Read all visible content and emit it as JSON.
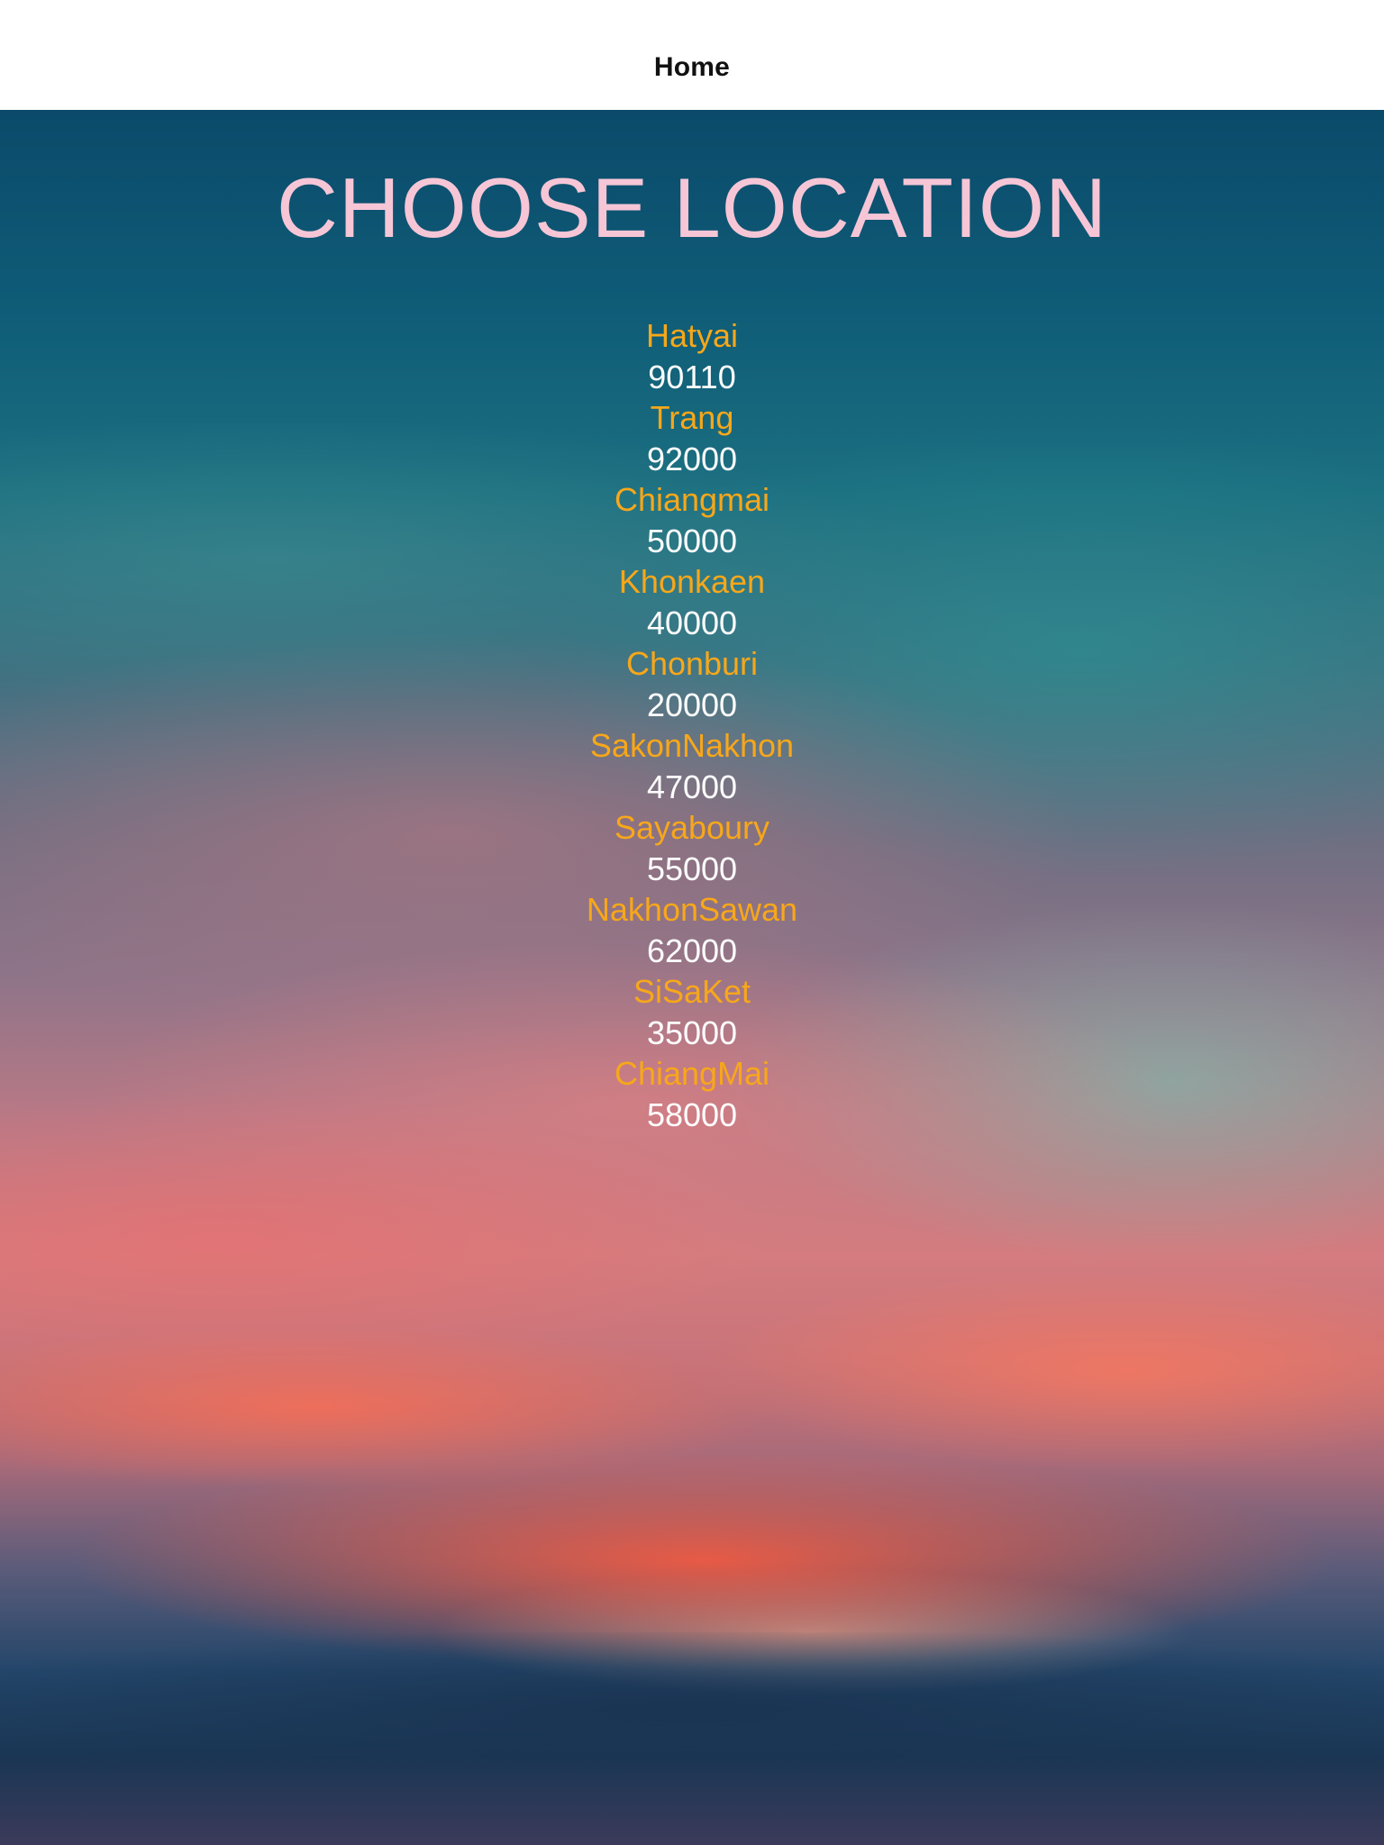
{
  "nav": {
    "title": "Home"
  },
  "page": {
    "title": "CHOOSE LOCATION"
  },
  "colors": {
    "title": "#f6c6d6",
    "location_name": "#f7a71a",
    "zip": "#ffffff"
  },
  "locations": [
    {
      "name": "Hatyai",
      "zip": "90110"
    },
    {
      "name": "Trang",
      "zip": "92000"
    },
    {
      "name": "Chiangmai",
      "zip": "50000"
    },
    {
      "name": "Khonkaen",
      "zip": "40000"
    },
    {
      "name": "Chonburi",
      "zip": "20000"
    },
    {
      "name": "SakonNakhon",
      "zip": "47000"
    },
    {
      "name": "Sayaboury",
      "zip": "55000"
    },
    {
      "name": "NakhonSawan",
      "zip": "62000"
    },
    {
      "name": "SiSaKet",
      "zip": "35000"
    },
    {
      "name": "ChiangMai",
      "zip": "58000"
    }
  ]
}
